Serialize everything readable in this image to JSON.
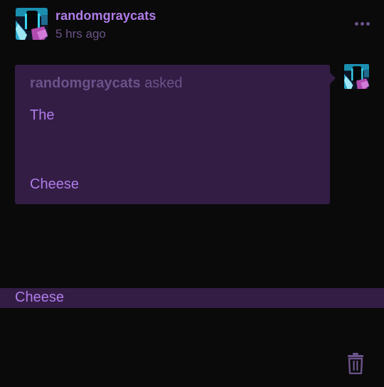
{
  "post": {
    "username": "randomgraycats",
    "timestamp": "5 hrs ago",
    "more_icon": "more-dots-icon"
  },
  "ask": {
    "asker": "randomgraycats",
    "verb": "asked",
    "lines": [
      "The",
      "Cheese"
    ]
  },
  "answer": {
    "text": "Cheese"
  },
  "actions": {
    "delete_icon": "trash-icon"
  },
  "colors": {
    "background": "#0a0a0a",
    "accent": "#b07ce8",
    "muted": "#6b5389",
    "box": "#331d45"
  }
}
